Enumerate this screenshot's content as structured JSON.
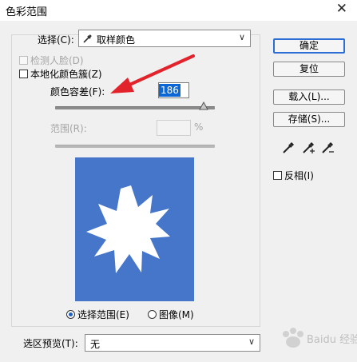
{
  "window": {
    "title": "色彩范围",
    "close_glyph": "✕"
  },
  "select": {
    "label": "选择(C):",
    "value": "取样颜色",
    "icon": "eyedropper-icon"
  },
  "options": {
    "detect_faces": "检测人脸(D)",
    "localized": "本地化颜色簇(Z)"
  },
  "fuzziness": {
    "label": "颜色容差(F):",
    "value": "186",
    "level": 186,
    "max": 200
  },
  "range": {
    "label": "范围(R):",
    "value": "",
    "unit": "%"
  },
  "preview_mode": {
    "selection": "选择范围(E)",
    "image": "图像(M)",
    "selected": "selection"
  },
  "selection_preview": {
    "label": "选区预览(T):",
    "value": "无"
  },
  "buttons": {
    "ok": "确定",
    "reset": "复位",
    "load": "载入(L)...",
    "save": "存储(S)..."
  },
  "tools": [
    "eyedropper-icon",
    "eyedropper-plus-icon",
    "eyedropper-minus-icon"
  ],
  "invert": "反相(I)",
  "watermark": {
    "text": "Baidu 经验"
  },
  "colors": {
    "accent": "#2c6ed5",
    "preview_bg": "#4676c9",
    "arrow": "#e3232b",
    "highlight": "#0b66d6"
  }
}
